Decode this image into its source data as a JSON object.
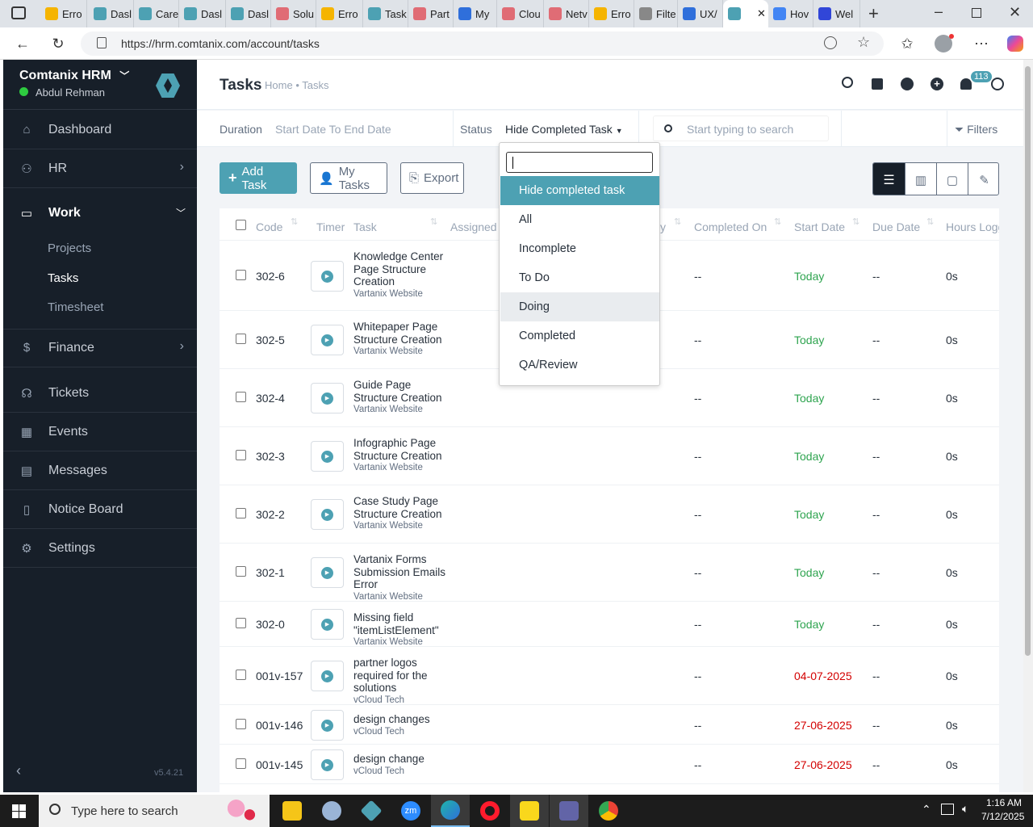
{
  "browser": {
    "tabs": [
      {
        "label": "Erro",
        "color": "#f5b400"
      },
      {
        "label": "Dasl",
        "color": "#4da1b3"
      },
      {
        "label": "Care",
        "color": "#4da1b3"
      },
      {
        "label": "Dasl",
        "color": "#4da1b3"
      },
      {
        "label": "Dasl",
        "color": "#4da1b3"
      },
      {
        "label": "Solu",
        "color": "#e06c75"
      },
      {
        "label": "Erro",
        "color": "#f5b400"
      },
      {
        "label": "Task",
        "color": "#4da1b3"
      },
      {
        "label": "Part",
        "color": "#e06c75"
      },
      {
        "label": "My",
        "color": "#2f6fdb"
      },
      {
        "label": "Clou",
        "color": "#e06c75"
      },
      {
        "label": "Netv",
        "color": "#e06c75"
      },
      {
        "label": "Erro",
        "color": "#f5b400"
      },
      {
        "label": "Filte",
        "color": "#888888"
      },
      {
        "label": "UX/",
        "color": "#2f6fdb"
      },
      {
        "label": "",
        "color": "#4da1b3"
      },
      {
        "label": "Hov",
        "color": "#4285f4"
      },
      {
        "label": "Wel",
        "color": "#3146d8"
      }
    ],
    "url": "https://hrm.comtanix.com/account/tasks"
  },
  "sidebar": {
    "company": "Comtanix HRM",
    "user": "Abdul Rehman",
    "items": [
      {
        "label": "Dashboard",
        "icon": "house-icon"
      },
      {
        "label": "HR",
        "icon": "people-icon"
      },
      {
        "label": "Work",
        "icon": "briefcase-icon"
      },
      {
        "label": "Finance",
        "icon": "dollar-icon"
      },
      {
        "label": "Tickets",
        "icon": "headset-icon"
      },
      {
        "label": "Events",
        "icon": "calendar-icon"
      },
      {
        "label": "Messages",
        "icon": "chat-icon"
      },
      {
        "label": "Notice Board",
        "icon": "clipboard-icon"
      },
      {
        "label": "Settings",
        "icon": "gear-icon"
      }
    ],
    "work_sub": [
      "Projects",
      "Tasks",
      "Timesheet"
    ],
    "version": "v5.4.21"
  },
  "header": {
    "title": "Tasks",
    "breadcrumb_home": "Home",
    "breadcrumb_sep": "•",
    "breadcrumb_current": "Tasks",
    "notification_count": "113"
  },
  "filters": {
    "duration_label": "Duration",
    "duration_placeholder": "Start Date To End Date",
    "status_label": "Status",
    "status_value": "Hide Completed Task",
    "search_placeholder": "Start typing to search",
    "filters_label": "Filters"
  },
  "actions": {
    "add_task": "Add Task",
    "my_tasks": "My Tasks",
    "export": "Export"
  },
  "table": {
    "columns": [
      "Code",
      "Timer",
      "Task",
      "Assigned",
      "y",
      "Completed On",
      "Start Date",
      "Due Date",
      "Hours Logg"
    ],
    "rows": [
      {
        "code": "302-6",
        "task": "Knowledge Center Page Structure Creation",
        "project": "Vartanix Website",
        "completed": "--",
        "start": "Today",
        "due": "--",
        "hours": "0s"
      },
      {
        "code": "302-5",
        "task": "Whitepaper Page Structure Creation",
        "project": "Vartanix Website",
        "completed": "--",
        "start": "Today",
        "due": "--",
        "hours": "0s"
      },
      {
        "code": "302-4",
        "task": "Guide Page Structure Creation",
        "project": "Vartanix Website",
        "completed": "--",
        "start": "Today",
        "due": "--",
        "hours": "0s"
      },
      {
        "code": "302-3",
        "task": "Infographic Page Structure Creation",
        "project": "Vartanix Website",
        "completed": "--",
        "start": "Today",
        "due": "--",
        "hours": "0s"
      },
      {
        "code": "302-2",
        "task": "Case Study Page Structure Creation",
        "project": "Vartanix Website",
        "completed": "--",
        "start": "Today",
        "due": "--",
        "hours": "0s"
      },
      {
        "code": "302-1",
        "task": "Vartanix Forms Submission Emails Error",
        "project": "Vartanix Website",
        "completed": "--",
        "start": "Today",
        "due": "--",
        "hours": "0s"
      },
      {
        "code": "302-0",
        "task": "Missing field \"itemListElement\"",
        "project": "Vartanix Website",
        "completed": "--",
        "start": "Today",
        "due": "--",
        "hours": "0s"
      },
      {
        "code": "001v-157",
        "task": "partner logos required for the solutions",
        "project": "vCloud Tech",
        "completed": "--",
        "start": "04-07-2025",
        "due": "--",
        "hours": "0s"
      },
      {
        "code": "001v-146",
        "task": "design changes",
        "project": "vCloud Tech",
        "completed": "--",
        "start": "27-06-2025",
        "due": "--",
        "hours": "0s"
      },
      {
        "code": "001v-145",
        "task": "design change",
        "project": "vCloud Tech",
        "completed": "--",
        "start": "27-06-2025",
        "due": "--",
        "hours": "0s"
      }
    ]
  },
  "status_dropdown": {
    "search_value": "",
    "options": [
      "Hide completed task",
      "All",
      "Incomplete",
      "To Do",
      "Doing",
      "Completed",
      "QA/Review"
    ],
    "selected": "Hide completed task",
    "hovered": "Doing"
  },
  "colors": {
    "accent": "#4da1b3",
    "sidebar_bg": "#171f29",
    "today_green": "#2ea44f",
    "overdue_red": "#d30000"
  },
  "taskbar": {
    "search_placeholder": "Type here to search",
    "time": "1:16 AM",
    "date": "7/12/2025"
  }
}
